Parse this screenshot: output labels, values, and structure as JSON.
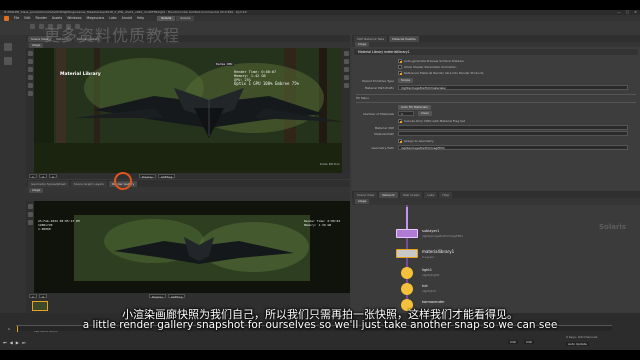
{
  "window": {
    "title": "H:/MILLER_Class_production/shots/018/lighting/scenes_files/backup/t018_0_PHL_shot1_v010_multiTTR/light - Houdini Indie Limited-Commercial 20.0.590 - Py3.10",
    "controls": [
      "—",
      "▢",
      "✕"
    ]
  },
  "menubar": {
    "items": [
      "File",
      "Edit",
      "Render",
      "Assets",
      "Windows",
      "Megascans",
      "Labs",
      "Arnold",
      "Help"
    ],
    "desktop_tabs": [
      {
        "label": "Solaris",
        "active": true
      },
      {
        "label": "Solaris",
        "active": false
      }
    ]
  },
  "top_viewport": {
    "tabs": [
      "Scene View",
      "Network",
      "Render Gallery"
    ],
    "path": "stage",
    "overlay_title": "Material Library",
    "render_label": "Karma XPU",
    "render_stats": "Render Time: 0:00:07\nMemory: 1.42 GB\nXPU: 25%",
    "render_stats_alt": "Optix 1 GPU 100%  Embree 75%",
    "strip_fields": [
      "1",
      "4",
      "4",
      "Display",
      "ACEScg"
    ],
    "corner_tag": "Indie Edition"
  },
  "bottom_viewport": {
    "tabs": [
      "Geometry Spreadsheet",
      "Scene Graph Layers",
      "Render Gallery"
    ],
    "path": "stage",
    "stamp": "23-Feb-2024 08:05:13 PM\n1280x720\n1.00000",
    "render_stats": "Render Time: 0:00:04\nMemory: 1.39 GB",
    "strip_fields": [
      "1",
      "4",
      "Display",
      "ACEScg"
    ]
  },
  "params": {
    "tabs": [
      "SOP Network Tabs",
      "Material Palette"
    ],
    "path": "stage",
    "header": "Material Library  materiallibrary1",
    "toggles": [
      {
        "label": "Auto-generate Preview Surface Shaders",
        "on": true
      },
      {
        "label": "Allow Shader Parameter Animation",
        "on": false
      },
      {
        "label": "Reference Material Render Vars Into Render Products",
        "on": true
      }
    ],
    "parent_prim_type_label": "Parent Primitive Type",
    "parent_prim_type_value": "Scope",
    "material_path_prefix_label": "Material Path Prefix",
    "material_path_prefix_value": "/lights/megafireTrill/materials/",
    "fill_menu_label": "Fill Menu",
    "auto_fill_button": "Auto Fill Materials",
    "number_of_materials_label": "Number of Materials",
    "number_of_materials_value": "1",
    "clear_button": "Clear",
    "include_label": "Include Only VOPs with Material Flag Set",
    "material_vop_label": "Material VOP",
    "material_path_label": "Material Path",
    "assign_label": "Assign to Geometry",
    "geometry_path_label": "Geometry Path",
    "geometry_path_value": "/lights/megafireTrill/megFE01"
  },
  "network": {
    "tabs": [
      "Scene View",
      "Network",
      "Task Graph",
      "Labs",
      "Help"
    ],
    "path": "stage",
    "context_label": "Solaris",
    "nodes": [
      {
        "name": "sublayer1",
        "sub": "/lights/megafireTrill/megFE01",
        "color": "#b07bd4",
        "kind": "box"
      },
      {
        "name": "materiallibrary1",
        "sub": "2 Layers",
        "color": "#c8c8c8",
        "kind": "box"
      },
      {
        "name": "light1",
        "sub": "/lights/light1",
        "color": "#f4c23a",
        "kind": "light"
      },
      {
        "name": "hdr",
        "sub": "/lights/hdr",
        "color": "#f4c23a",
        "kind": "light"
      },
      {
        "name": "karmarender",
        "sub": "2 Layers",
        "color": "#f4c23a",
        "kind": "light"
      }
    ]
  },
  "timeline": {
    "start": "1",
    "end": "240",
    "current": "1",
    "range_end_a": "240",
    "range_end_b": "240",
    "status_right": "0 Keys, 0/0 Channels",
    "auto_update": "Auto Update",
    "stamp_left": "Feb 2024 08:05"
  },
  "subtitles": {
    "zh": "小渲染画廊快照为我们自己，所以我们只需再拍一张快照，这样我们才能看得见。",
    "en": "a little render gallery snapshot for ourselves so we'll just take another snap so we can see"
  },
  "watermark": "更多资料优质教程",
  "colors": {
    "accent": "#e8a21e",
    "cursor_ring": "#e2561e",
    "node_purple": "#b07bd4",
    "node_yellow": "#f4c23a",
    "wire_purple": "#9b59d6"
  }
}
